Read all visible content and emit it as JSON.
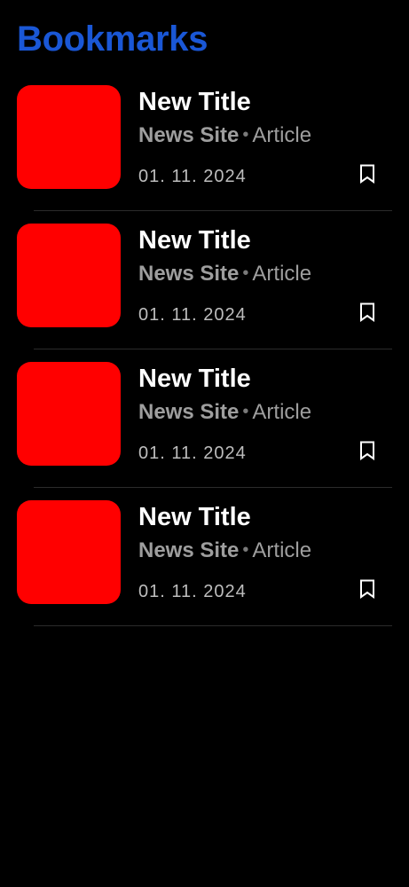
{
  "header": {
    "title": "Bookmarks"
  },
  "colors": {
    "background": "#000000",
    "title": "#1a57d6",
    "thumbnail": "#ff0000",
    "text_primary": "#ffffff",
    "text_secondary": "#9e9e9e"
  },
  "bookmarks": [
    {
      "title": "New Title",
      "site": "News Site",
      "separator": "•",
      "category": "Article",
      "date": "01. 11. 2024",
      "icon": "bookmark-icon"
    },
    {
      "title": "New Title",
      "site": "News Site",
      "separator": "•",
      "category": "Article",
      "date": "01. 11. 2024",
      "icon": "bookmark-icon"
    },
    {
      "title": "New Title",
      "site": "News Site",
      "separator": "•",
      "category": "Article",
      "date": "01. 11. 2024",
      "icon": "bookmark-icon"
    },
    {
      "title": "New Title",
      "site": "News Site",
      "separator": "•",
      "category": "Article",
      "date": "01. 11. 2024",
      "icon": "bookmark-icon"
    }
  ]
}
